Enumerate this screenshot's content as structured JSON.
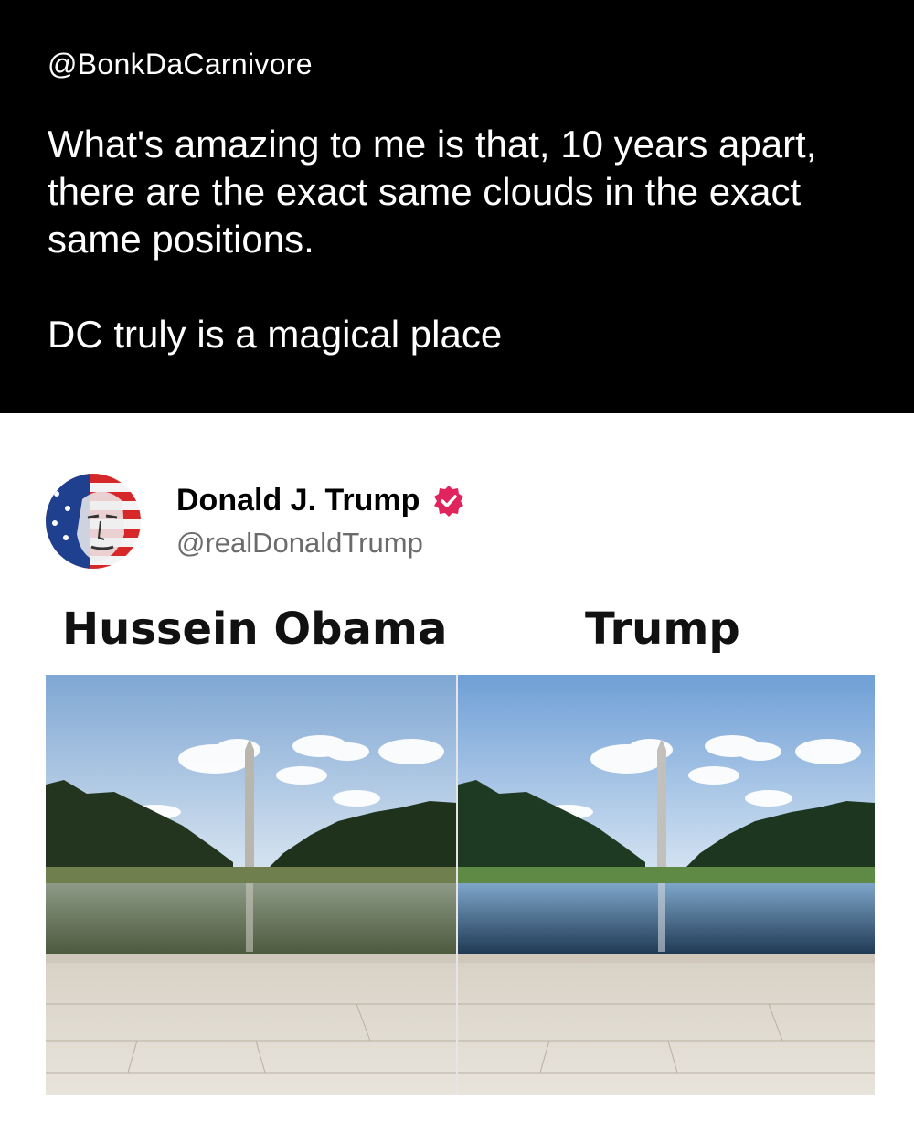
{
  "post": {
    "handle": "@BonkDaCarnivore",
    "line1": "What's amazing to me is that, 10 years apart, there are the exact same clouds in the exact same positions.",
    "line2": "DC truly is a magical place"
  },
  "embedded": {
    "name": "Donald J. Trump",
    "handle": "@realDonaldTrump",
    "badge_icon": "verified-badge-icon",
    "badge_color": "#e0245e",
    "label_left": "Hussein Obama",
    "label_right": "Trump"
  }
}
